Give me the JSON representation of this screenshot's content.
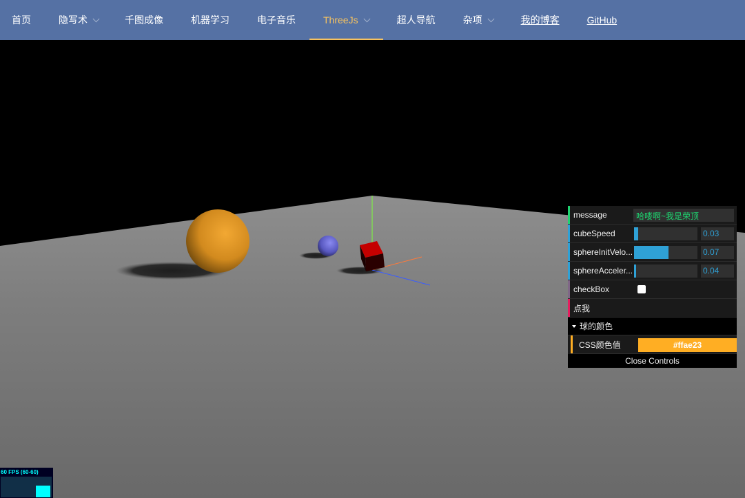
{
  "nav": {
    "items": [
      {
        "label": "首页",
        "dropdown": false,
        "active": false,
        "underline": false
      },
      {
        "label": "隐写术",
        "dropdown": true,
        "active": false,
        "underline": false
      },
      {
        "label": "千图成像",
        "dropdown": false,
        "active": false,
        "underline": false
      },
      {
        "label": "机器学习",
        "dropdown": false,
        "active": false,
        "underline": false
      },
      {
        "label": "电子音乐",
        "dropdown": false,
        "active": false,
        "underline": false
      },
      {
        "label": "ThreeJs",
        "dropdown": true,
        "active": true,
        "underline": false
      },
      {
        "label": "超人导航",
        "dropdown": false,
        "active": false,
        "underline": false
      },
      {
        "label": "杂项",
        "dropdown": true,
        "active": false,
        "underline": false
      },
      {
        "label": "我的博客",
        "dropdown": false,
        "active": false,
        "underline": true
      },
      {
        "label": "GitHub",
        "dropdown": false,
        "active": false,
        "underline": true
      }
    ],
    "background": "#5571a4",
    "active_color": "#f7c35f"
  },
  "gui": {
    "message": {
      "label": "message",
      "value": "哈喽啊~我是荣顶"
    },
    "cubeSpeed": {
      "label": "cubeSpeed",
      "value": "0.03",
      "fraction": 0.07
    },
    "sphereInitVelocity": {
      "label": "sphereInitVelo...",
      "value": "0.07",
      "fraction": 0.54
    },
    "sphereAcceleration": {
      "label": "sphereAcceler...",
      "value": "0.04",
      "fraction": 0.03
    },
    "checkBox": {
      "label": "checkBox",
      "checked": false
    },
    "button": {
      "label": "点我"
    },
    "folder": {
      "title": "球的颜色"
    },
    "cssColor": {
      "label": "CSS颜色值",
      "value": "#ffae23"
    },
    "close_label": "Close Controls",
    "colors": {
      "string_bar": "#1ed36f",
      "number_bar": "#2fa1d6",
      "boolean_bar": "#806787",
      "function_bar": "#e61d5f",
      "color_bar": "#ffae23"
    }
  },
  "stats": {
    "text": "60 FPS (60-60)"
  }
}
